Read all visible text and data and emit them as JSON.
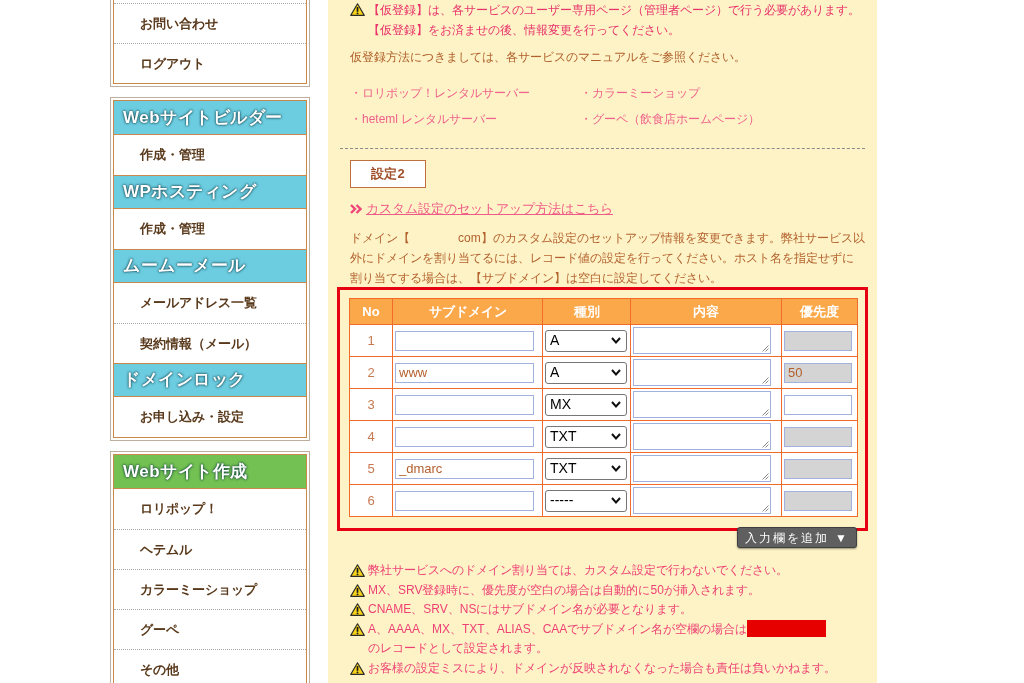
{
  "sidebar": {
    "panels": [
      {
        "items": [
          {
            "kind": "item",
            "label": "お問い合わせ"
          },
          {
            "kind": "item",
            "label": "ログアウト"
          }
        ]
      },
      {
        "items": [
          {
            "kind": "header",
            "label": "Webサイトビルダー",
            "color": "#6ccde0"
          },
          {
            "kind": "item",
            "label": "作成・管理"
          },
          {
            "kind": "header",
            "label": "WPホスティング",
            "color": "#6ccde0"
          },
          {
            "kind": "item",
            "label": "作成・管理"
          },
          {
            "kind": "header",
            "label": "ムームーメール",
            "color": "#6ccde0"
          },
          {
            "kind": "item",
            "label": "メールアドレス一覧"
          },
          {
            "kind": "item",
            "label": "契約情報（メール）"
          },
          {
            "kind": "header",
            "label": "ドメインロック",
            "color": "#6ccde0"
          },
          {
            "kind": "item",
            "label": "お申し込み・設定"
          }
        ]
      },
      {
        "items": [
          {
            "kind": "header",
            "label": "Webサイト作成",
            "color": "#72c152"
          },
          {
            "kind": "item",
            "label": "ロリポップ！"
          },
          {
            "kind": "item",
            "label": "ヘテムル"
          },
          {
            "kind": "item",
            "label": "カラーミーショップ"
          },
          {
            "kind": "item",
            "label": "グーペ"
          },
          {
            "kind": "item",
            "label": "その他"
          }
        ]
      }
    ]
  },
  "main": {
    "notice": "【仮登録】は、各サービスのユーザー専用ページ（管理者ページ）で行う必要があります。【仮登録】をお済ませの後、情報変更を行ってください。",
    "manual_note": "仮登録方法につきましては、各サービスのマニュアルをご参照ください。",
    "service_links": [
      "・ロリポップ！レンタルサーバー",
      "・カラーミーショップ",
      "・heteml レンタルサーバー",
      "・グーペ（飲食店ホームページ）"
    ],
    "section_label": "設定2",
    "setup_link": "カスタム設定のセットアップ方法はこちら",
    "description": "ドメイン【　　　　com】のカスタム設定のセットアップ情報を変更できます。弊社サービス以外にドメインを割り当てるには、レコード値の設定を行ってください。ホスト名を指定せずに割り当てする場合は、【サブドメイン】は空白に設定してください。",
    "records_table": {
      "columns": [
        "No",
        "サブドメイン",
        "種別",
        "内容",
        "優先度"
      ],
      "rows": [
        {
          "no": "1",
          "type": "A",
          "priority": {
            "disabled": true
          }
        },
        {
          "no": "2",
          "subdomain": "www",
          "type": "A",
          "priority": {
            "value": "50",
            "disabled": true
          }
        },
        {
          "no": "3",
          "type": "MX",
          "priority": {
            "disabled": false
          }
        },
        {
          "no": "4",
          "type": "TXT",
          "priority": {
            "disabled": true
          }
        },
        {
          "no": "5",
          "subdomain": "_dmarc",
          "type": "TXT",
          "priority": {
            "disabled": true
          }
        },
        {
          "no": "6",
          "type": "-----",
          "priority": {
            "disabled": true
          }
        }
      ]
    },
    "add_button": "入力欄を追加 ▼",
    "notes": [
      {
        "kind": "text",
        "text": "弊社サービスへのドメイン割り当ては、カスタム設定で行わないでください。"
      },
      {
        "kind": "text",
        "text": "MX、SRV登録時に、優先度が空白の場合は自動的に50が挿入されます。"
      },
      {
        "kind": "text",
        "text": "CNAME、SRV、NSにはサブドメイン名が必要となります。"
      },
      {
        "kind": "redacted",
        "text": "A、AAAA、MX、TXT、ALIAS、CAAでサブドメイン名が空欄の場合は",
        "text_after": "のレコードとして設定されます。"
      },
      {
        "kind": "text",
        "text": "お客様の設定ミスにより、ドメインが反映されなくなった場合も責任は負いかねます。"
      }
    ]
  }
}
